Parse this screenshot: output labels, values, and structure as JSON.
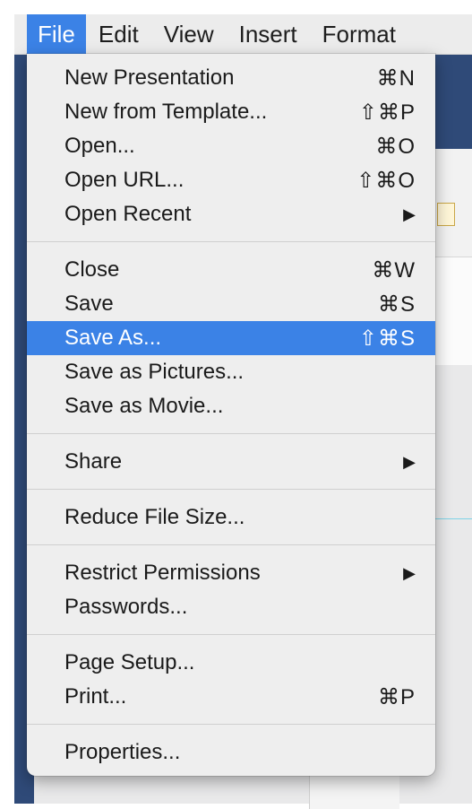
{
  "menubar": {
    "items": [
      "File",
      "Edit",
      "View",
      "Insert",
      "Format"
    ]
  },
  "menu": {
    "groups": [
      [
        {
          "label": "New Presentation",
          "shortcut": "⌘N"
        },
        {
          "label": "New from Template...",
          "shortcut": "⇧⌘P"
        },
        {
          "label": "Open...",
          "shortcut": "⌘O"
        },
        {
          "label": "Open URL...",
          "shortcut": "⇧⌘O"
        },
        {
          "label": "Open Recent",
          "submenu": "▶"
        }
      ],
      [
        {
          "label": "Close",
          "shortcut": "⌘W"
        },
        {
          "label": "Save",
          "shortcut": "⌘S"
        },
        {
          "label": "Save As...",
          "shortcut": "⇧⌘S",
          "highlighted": true
        },
        {
          "label": "Save as Pictures..."
        },
        {
          "label": "Save as Movie..."
        }
      ],
      [
        {
          "label": "Share",
          "submenu": "▶"
        }
      ],
      [
        {
          "label": "Reduce File Size..."
        }
      ],
      [
        {
          "label": "Restrict Permissions",
          "submenu": "▶"
        },
        {
          "label": "Passwords..."
        }
      ],
      [
        {
          "label": "Page Setup..."
        },
        {
          "label": "Print...",
          "shortcut": "⌘P"
        }
      ],
      [
        {
          "label": "Properties..."
        }
      ]
    ]
  },
  "colors": {
    "highlight": "#3b82e6",
    "menu_bg": "#eeeeee",
    "window_dark": "#2f4a78"
  }
}
